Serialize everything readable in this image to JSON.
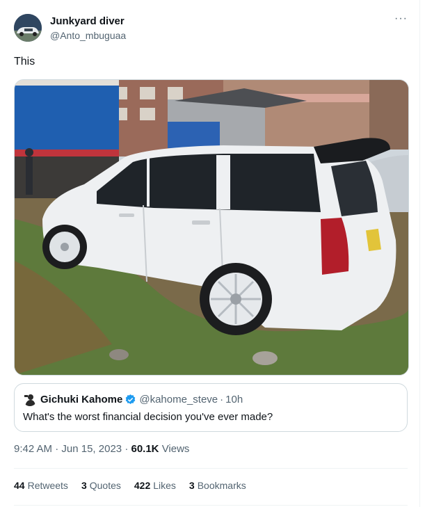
{
  "author": {
    "display_name": "Junkyard diver",
    "handle": "@Anto_mbuguaa",
    "avatar_icon": "avatar-car-photo"
  },
  "more_icon_glyph": "···",
  "tweet": {
    "text": "This",
    "media_description_icon": "photo-white-subaru-forester"
  },
  "quoted_tweet": {
    "display_name": "Gichuki Kahome",
    "handle": "@kahome_steve",
    "time": "10h",
    "separator": "·",
    "text": "What's the worst financial decision you've ever made?",
    "verified_icon": "verified-badge-icon",
    "verified_color": "#1d9bf0"
  },
  "meta": {
    "time": "9:42 AM",
    "date": "Jun 15, 2023",
    "separator": "·",
    "views_count": "60.1K",
    "views_label": "Views"
  },
  "stats": {
    "retweets_count": "44",
    "retweets_label": "Retweets",
    "quotes_count": "3",
    "quotes_label": "Quotes",
    "likes_count": "422",
    "likes_label": "Likes",
    "bookmarks_count": "3",
    "bookmarks_label": "Bookmarks"
  }
}
